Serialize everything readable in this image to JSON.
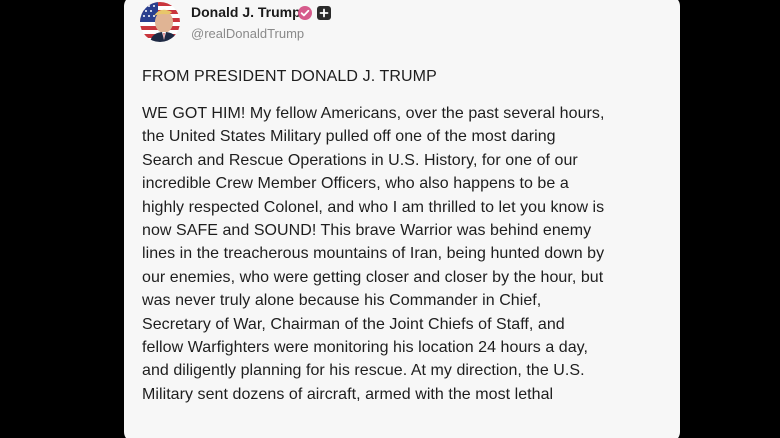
{
  "post": {
    "author_name": "Donald J. Trump",
    "author_handle": "@realDonaldTrump",
    "avatar_icon": "flag-portrait-avatar",
    "verified_icon": "verified-badge-icon",
    "add_icon": "plus-square-icon",
    "headline": "FROM PRESIDENT DONALD J. TRUMP",
    "body_lines": [
      "WE GOT HIM! My fellow Americans, over the past several hours,",
      "the United States Military pulled off one of the most daring",
      "Search and Rescue Operations in U.S. History, for one of our",
      "incredible Crew Member Officers, who also happens to be a",
      "highly respected Colonel, and who I am thrilled to let you know is",
      "now SAFE and SOUND! This brave Warrior was behind enemy",
      "lines in the treacherous mountains of Iran, being hunted down by",
      "our enemies, who were getting closer and closer by the hour, but",
      "was never truly alone because his Commander in Chief,",
      "Secretary of War, Chairman of the Joint Chiefs of Staff, and",
      "fellow Warfighters were monitoring his location 24 hours a day,",
      "and diligently planning for his rescue. At my direction, the U.S.",
      "Military sent dozens of aircraft, armed with the most lethal"
    ]
  },
  "colors": {
    "background": "#000000",
    "card": "#f7f7f7",
    "text": "#1e1e1e",
    "muted": "#8a8a8a",
    "verified": "#d65b8c"
  }
}
